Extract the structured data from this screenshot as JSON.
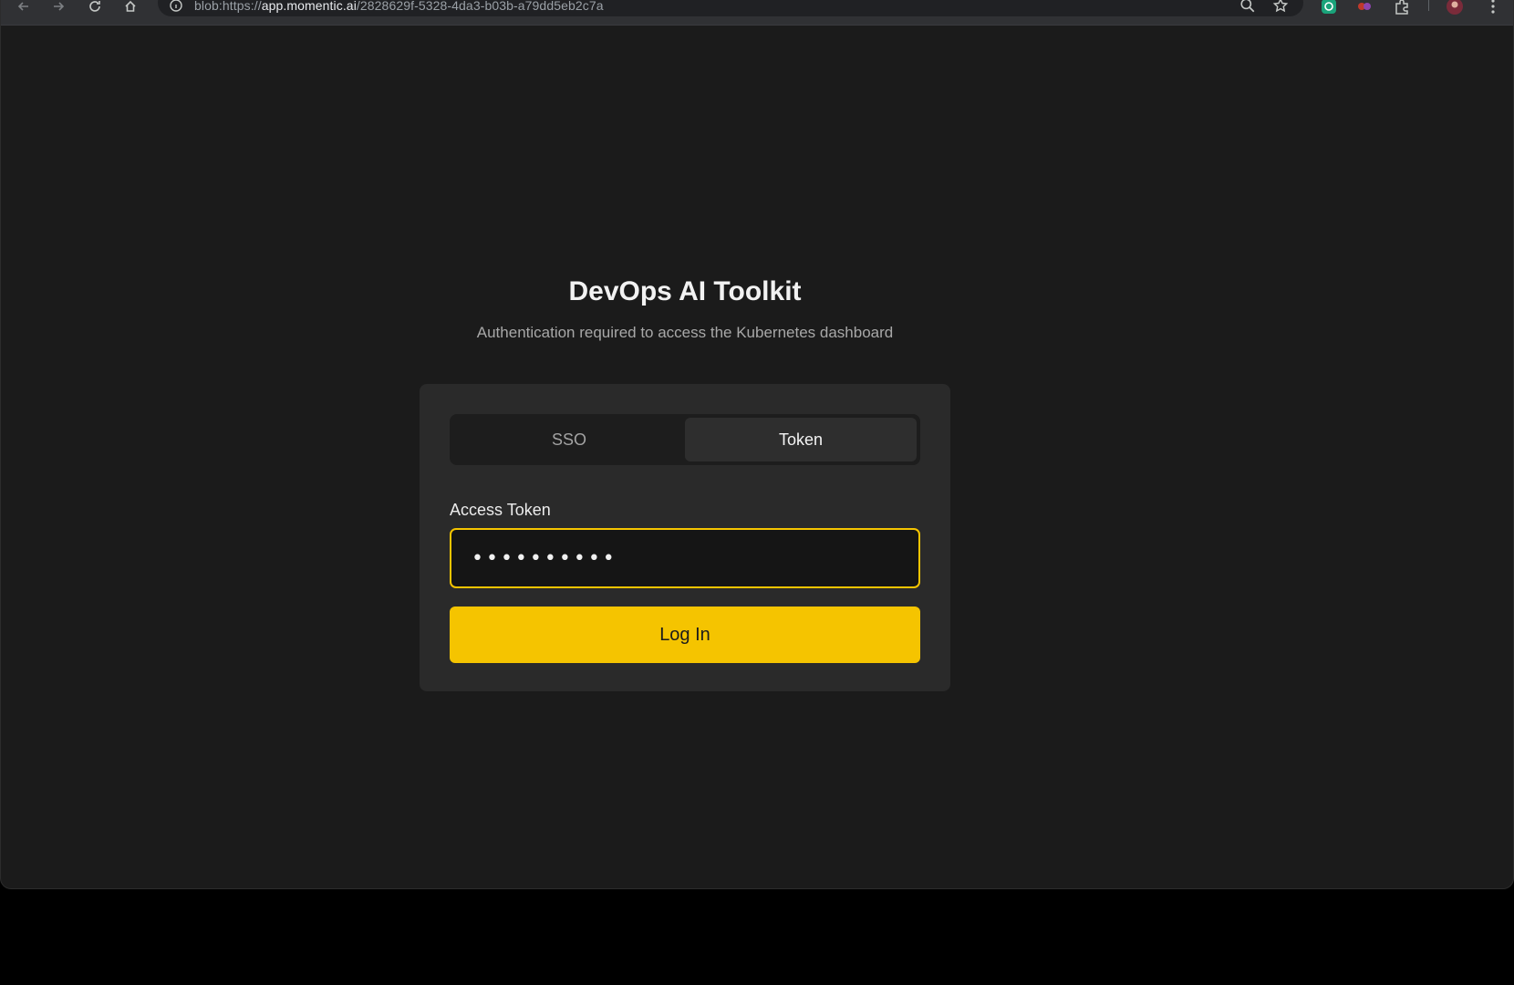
{
  "browser": {
    "url_prefix": "blob:https://",
    "url_host": "app.momentic.ai",
    "url_path": "/2828629f-5328-4da3-b03b-a79dd5eb2c7a",
    "icons": [
      "back-icon",
      "forward-icon",
      "reload-icon",
      "home-icon",
      "site-info-icon",
      "zoom-icon",
      "bookmark-star-icon",
      "extension-icon",
      "extensions-puzzle-icon",
      "profile-avatar",
      "menu-dots-icon"
    ]
  },
  "page": {
    "title": "DevOps AI Toolkit",
    "subtitle": "Authentication required to access the Kubernetes dashboard"
  },
  "auth": {
    "tabs": [
      {
        "label": "SSO",
        "active": false
      },
      {
        "label": "Token",
        "active": true
      }
    ],
    "token_label": "Access Token",
    "token_value": "••••••••••",
    "login_label": "Log In"
  },
  "colors": {
    "accent": "#f5c400",
    "background": "#1b1b1b",
    "card": "#2a2a2a"
  }
}
